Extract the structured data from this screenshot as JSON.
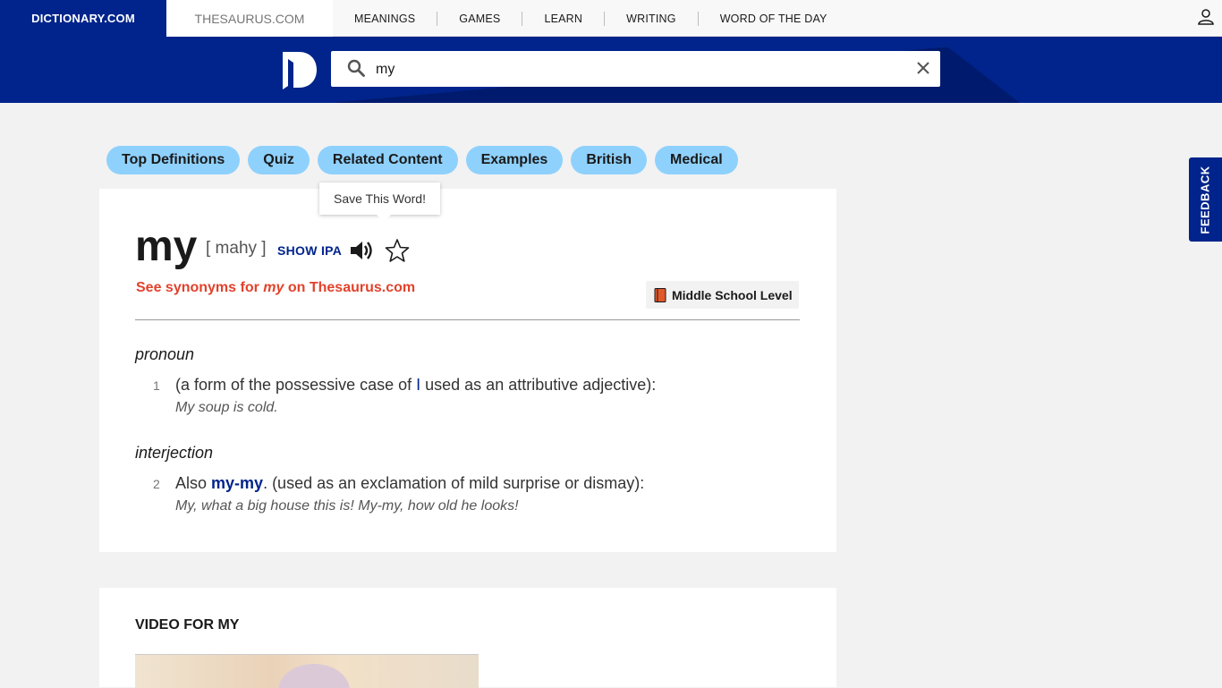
{
  "topnav": {
    "site_tab": "DICTIONARY.COM",
    "thesaurus_tab": "THESAURUS.COM",
    "links": [
      "MEANINGS",
      "GAMES",
      "LEARN",
      "WRITING",
      "WORD OF THE DAY"
    ]
  },
  "search": {
    "value": "my"
  },
  "pills": [
    "Top Definitions",
    "Quiz",
    "Related Content",
    "Examples",
    "British",
    "Medical"
  ],
  "feedback_label": "FEEDBACK",
  "entry": {
    "tooltip": "Save This Word!",
    "headword": "my",
    "pronunciation": "[ mahy ]",
    "show_ipa": "SHOW IPA",
    "synonyms_prefix": "See synonyms for ",
    "synonyms_word": "my",
    "synonyms_suffix": " on Thesaurus.com",
    "level": "Middle School Level",
    "senses": [
      {
        "pos": "pronoun",
        "number": "1",
        "def_before": "(a form of the possessive case of ",
        "def_link": "I",
        "def_after": " used as an attributive adjective):",
        "example": "My soup is cold."
      },
      {
        "pos": "interjection",
        "number": "2",
        "def_before": "Also ",
        "def_link": "my-my",
        "def_after": ". (used as an exclamation of mild surprise or dismay):",
        "example": "My, what a big house this is! My-my, how old he looks!"
      }
    ]
  },
  "video": {
    "title": "VIDEO FOR MY"
  },
  "colors": {
    "brand_blue": "#00248b",
    "pill_blue": "#8ed1fc",
    "synonym_red": "#e2422b"
  }
}
